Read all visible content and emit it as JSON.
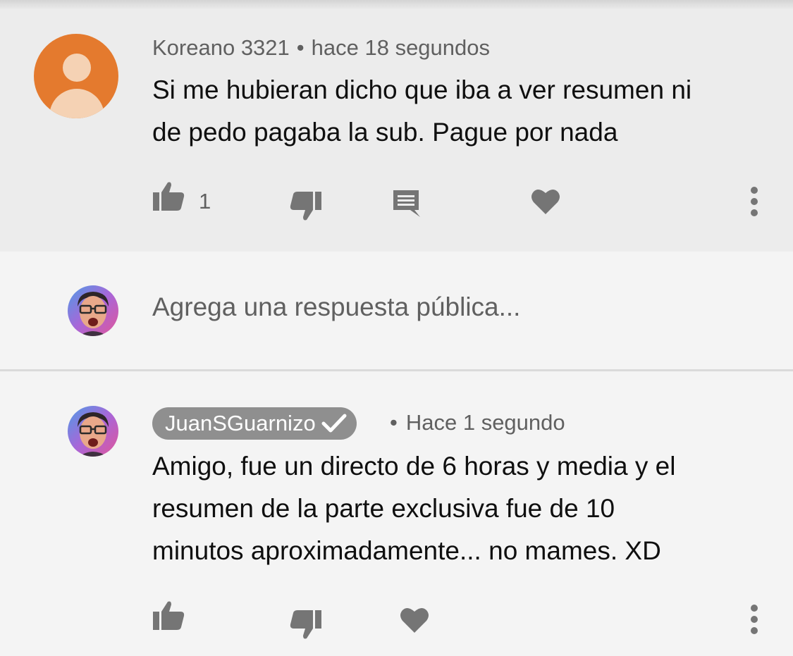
{
  "comment": {
    "author": "Koreano 3321",
    "separator": "•",
    "time": "hace 18 segundos",
    "text_lines": [
      "Si me hubieran dicho que iba a ver resumen ni",
      "de pedo pagaba la sub. Pague por nada"
    ],
    "like_count": "1",
    "avatar_color": "#e47a2e"
  },
  "reply_box": {
    "placeholder": "Agrega una respuesta pública..."
  },
  "reply": {
    "author": "JuanSGuarnizo",
    "verified": true,
    "separator": "•",
    "time": "Hace 1 segundo",
    "text_lines": [
      "Amigo, fue un directo de 6 horas y media y el",
      "resumen de la parte exclusiva fue de 10",
      "minutos aproximadamente... no mames. XD"
    ]
  },
  "icons": {
    "like": "thumbs-up-icon",
    "dislike": "thumbs-down-icon",
    "reply": "comment-icon",
    "heart": "heart-icon",
    "more": "more-vert-icon"
  },
  "colors": {
    "icon_gray": "#757575",
    "badge_bg": "#8f8f8f"
  }
}
